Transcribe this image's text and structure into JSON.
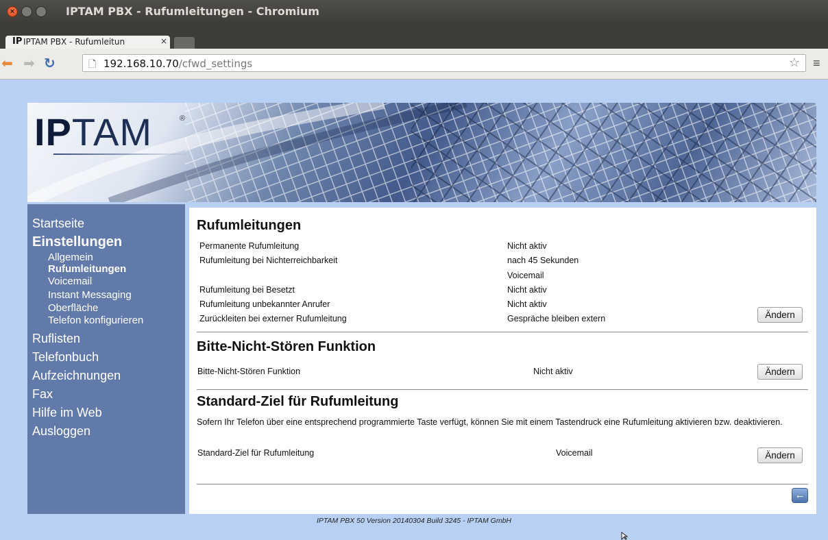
{
  "window": {
    "title": "IPTAM PBX - Rufumleitungen - Chromium",
    "tab_label": "IPTAM PBX - Rufumleitun",
    "tab_favicon": "IP",
    "close_glyph": "×"
  },
  "address_bar": {
    "host": "192.168.10.70",
    "path": "/cfwd_settings"
  },
  "brand": {
    "logo_bold": "IP",
    "logo_light": "TAM",
    "logo_mark": "®"
  },
  "sidebar": {
    "startseite": "Startseite",
    "einstellungen": "Einstellungen",
    "sub": [
      "Allgemein",
      "Rufumleitungen",
      "Voicemail",
      "Instant Messaging",
      "Oberfläche",
      "Telefon konfigurieren"
    ],
    "rest": [
      "Ruflisten",
      "Telefonbuch",
      "Aufzeichnungen",
      "Fax",
      "Hilfe im Web",
      "Ausloggen"
    ]
  },
  "rufumleitungen": {
    "heading": "Rufumleitungen",
    "rows": [
      {
        "label": "Permanente Rufumleitung",
        "value": "Nicht aktiv"
      },
      {
        "label": "Rufumleitung bei Nichterreichbarkeit",
        "value": "nach 45 Sekunden",
        "value2": "Voicemail"
      },
      {
        "label": "Rufumleitung bei Besetzt",
        "value": "Nicht aktiv"
      },
      {
        "label": "Rufumleitung unbekannter Anrufer",
        "value": "Nicht aktiv"
      },
      {
        "label": "Zurückleiten bei externer Rufumleitung",
        "value": "Gespräche bleiben extern"
      }
    ],
    "button": "Ändern"
  },
  "dnd": {
    "heading": "Bitte-Nicht-Stören Funktion",
    "label": "Bitte-Nicht-Stören Funktion",
    "value": "Nicht aktiv",
    "button": "Ändern"
  },
  "standard": {
    "heading": "Standard-Ziel für Rufumleitung",
    "description": "Sofern Ihr Telefon über eine entsprechend programmierte Taste verfügt, können Sie mit einem Tastendruck eine Rufumleitung aktivieren bzw. deaktivieren.",
    "label": "Standard-Ziel für Rufumleitung",
    "value": "Voicemail",
    "button": "Ändern"
  },
  "footer": "IPTAM PBX 50 Version 20140304 Build 3245 - IPTAM GmbH",
  "icons": {
    "back": "arrow-left-icon",
    "forward": "arrow-right-icon",
    "reload": "reload-icon",
    "page": "page-icon",
    "star": "star-icon",
    "menu": "menu-icon"
  }
}
